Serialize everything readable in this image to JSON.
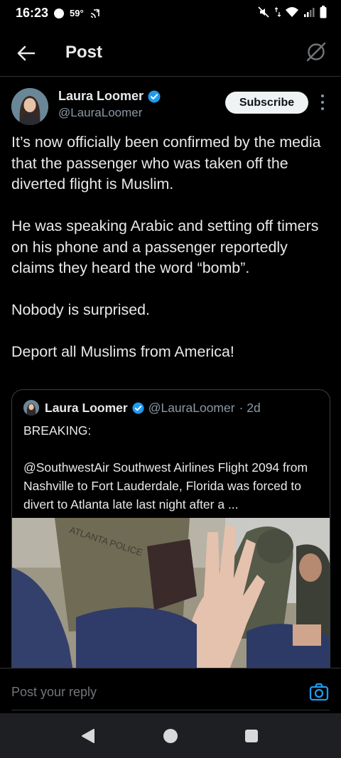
{
  "status_bar": {
    "time": "16:23",
    "temperature": "59°",
    "icons": [
      "record-dot-icon",
      "cast-icon",
      "mute-icon",
      "data-arrows-icon",
      "wifi-icon",
      "signal-icon",
      "battery-icon"
    ]
  },
  "header": {
    "title": "Post",
    "back_icon": "arrow-left-icon",
    "grok_icon": "grok-icon"
  },
  "post": {
    "author": {
      "name": "Laura Loomer",
      "handle": "@LauraLoomer",
      "verified": true
    },
    "subscribe_label": "Subscribe",
    "paragraphs": [
      "It’s now officially been confirmed by the media that the passenger who was taken off the diverted flight is Muslim.",
      "He was speaking Arabic and setting off timers on his phone and a passenger reportedly claims they heard the word “bomb”.",
      "Nobody is surprised.",
      "Deport all Muslims from America!"
    ],
    "quote": {
      "author_name": "Laura Loomer",
      "handle": "@LauraLoomer",
      "time": "· 2d",
      "line1": "BREAKING:",
      "line2": "@SouthwestAir Southwest Airlines Flight 2094 from Nashville to Fort Lauderdale, Florida was forced to divert to Atlanta late last night after a ...",
      "image_text": "ATLANTA POLICE"
    }
  },
  "reply": {
    "placeholder": "Post your reply",
    "camera_icon": "camera-icon"
  },
  "nav": {
    "icons": [
      "nav-back-icon",
      "nav-home-icon",
      "nav-recents-icon"
    ]
  },
  "colors": {
    "background": "#000000",
    "text": "#e7e9ea",
    "secondary_text": "#8b98a5",
    "accent_blue": "#1d9bf0",
    "border": "#2f3336",
    "nav_bar": "#1e1f22"
  }
}
